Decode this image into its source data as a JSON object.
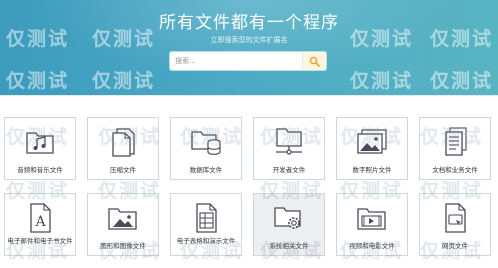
{
  "header": {
    "title": "所有文件都有一个程序",
    "subtitle": "立即搜索您的文件扩展名"
  },
  "search": {
    "placeholder": "搜索...",
    "value": "",
    "icon": "search-icon"
  },
  "watermark_text": "仅测试",
  "colors": {
    "hero_start": "#3d9bbd",
    "hero_end": "#59b4c2",
    "icon_stroke": "#4a4a5a",
    "search_icon": "#e8a33c"
  },
  "categories": [
    {
      "label": "音频和音乐文件",
      "icon": "music-folder-icon"
    },
    {
      "label": "压缩文件",
      "icon": "compressed-files-icon"
    },
    {
      "label": "数据库文件",
      "icon": "database-folder-icon"
    },
    {
      "label": "开发者文件",
      "icon": "network-folder-icon"
    },
    {
      "label": "数字照片文件",
      "icon": "photos-icon"
    },
    {
      "label": "文档和业务文件",
      "icon": "document-icon"
    },
    {
      "label": "电子邮件和电子书文件",
      "icon": "font-document-icon"
    },
    {
      "label": "图形和图像文件",
      "icon": "image-folder-icon"
    },
    {
      "label": "电子表格和演示文件",
      "icon": "spreadsheet-icon"
    },
    {
      "label": "系统相关文件",
      "icon": "settings-folder-icon"
    },
    {
      "label": "视频和电影文件",
      "icon": "video-folder-icon"
    },
    {
      "label": "网页文件",
      "icon": "web-page-icon"
    }
  ]
}
